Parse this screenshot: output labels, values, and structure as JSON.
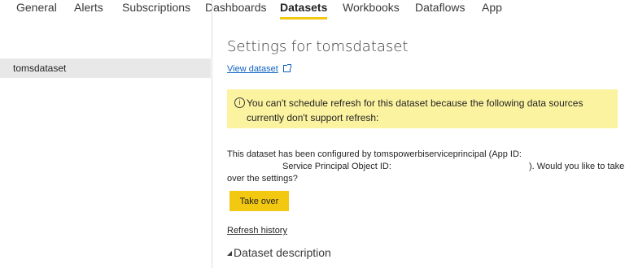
{
  "tabs": [
    {
      "label": "General"
    },
    {
      "label": "Alerts"
    },
    {
      "label": "Subscriptions"
    },
    {
      "label": "Dashboards"
    },
    {
      "label": "Datasets"
    },
    {
      "label": "Workbooks"
    },
    {
      "label": "Dataflows"
    },
    {
      "label": "App"
    }
  ],
  "active_tab": "Datasets",
  "accent_color": "#f2c811",
  "sidebar": {
    "items": [
      {
        "label": "tomsdataset",
        "selected": true
      }
    ]
  },
  "main": {
    "title": "Settings for tomsdataset",
    "view_link": "View dataset",
    "view_link_icon": "external-link-icon",
    "warning": {
      "icon": "info-icon",
      "text": "You can't schedule refresh for this dataset because the following data sources currently don't support refresh:"
    },
    "config": {
      "line1": "This dataset has been configured by tomspowerbiserviceprincipal (App ID:",
      "line2a": "Service Principal Object ID:",
      "line2b": "). Would you like to take",
      "line3": "over the settings?"
    },
    "takeover_label": "Take over",
    "refresh_history": "Refresh history",
    "dataset_description": "Dataset description"
  }
}
